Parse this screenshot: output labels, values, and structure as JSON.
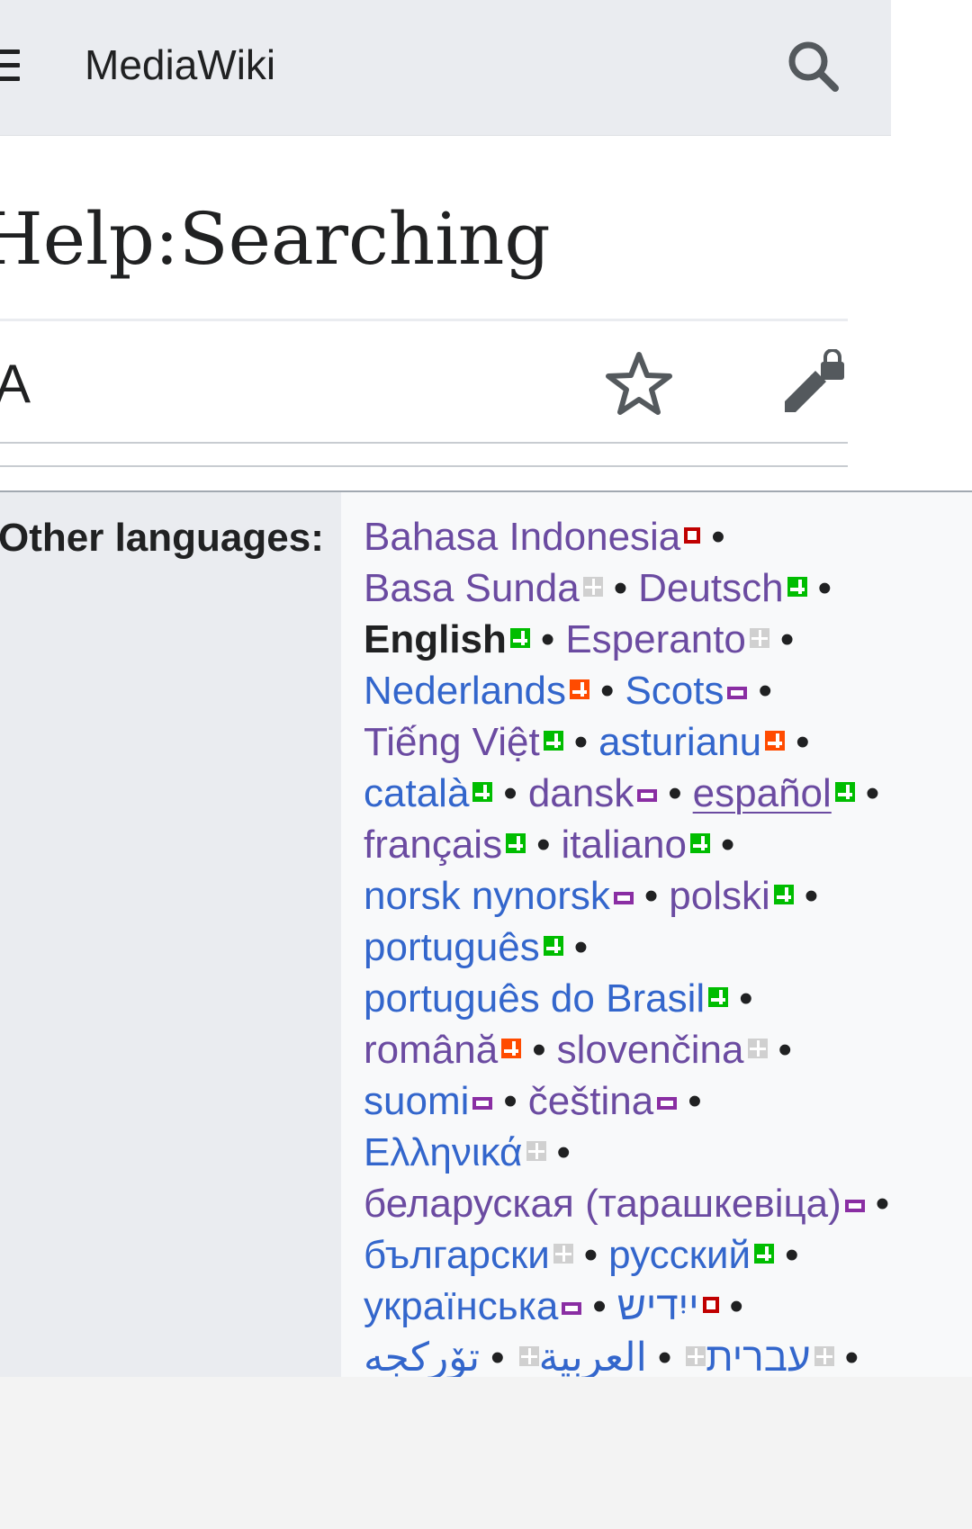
{
  "header": {
    "site_name": "MediaWiki",
    "icons": {
      "menu": "hamburger-menu-icon",
      "search": "search-icon"
    }
  },
  "page": {
    "title": "Help:Searching"
  },
  "actions": {
    "language_icon_text": "A",
    "icons": {
      "language": "language-icon",
      "watch": "star-icon",
      "edit": "edit-lock-icon"
    }
  },
  "languages": {
    "label": "Other languages:",
    "separator": "•",
    "lines": [
      [
        {
          "name": "Bahasa Indonesia",
          "style": "visited",
          "status": "low"
        }
      ],
      [
        {
          "name": "Basa Sunda",
          "style": "visited",
          "status": "none"
        },
        {
          "name": "Deutsch",
          "style": "visited",
          "status": "complete"
        }
      ],
      [
        {
          "name": "English",
          "style": "current",
          "status": "complete"
        },
        {
          "name": "Esperanto",
          "style": "visited",
          "status": "none"
        }
      ],
      [
        {
          "name": "Nederlands",
          "style": "link",
          "status": "high"
        },
        {
          "name": "Scots",
          "style": "link",
          "status": "mid"
        }
      ],
      [
        {
          "name": "Tiếng Việt",
          "style": "visited",
          "status": "complete"
        },
        {
          "name": "asturianu",
          "style": "link",
          "status": "high"
        }
      ],
      [
        {
          "name": "català",
          "style": "link",
          "status": "complete"
        },
        {
          "name": "dansk",
          "style": "visited",
          "status": "mid"
        },
        {
          "name": "español",
          "style": "visited-underline",
          "status": "complete"
        }
      ],
      [
        {
          "name": "français",
          "style": "visited",
          "status": "complete"
        },
        {
          "name": "italiano",
          "style": "visited",
          "status": "complete"
        }
      ],
      [
        {
          "name": "norsk nynorsk",
          "style": "link",
          "status": "mid"
        },
        {
          "name": "polski",
          "style": "visited",
          "status": "complete"
        }
      ],
      [
        {
          "name": "português",
          "style": "link",
          "status": "complete"
        }
      ],
      [
        {
          "name": "português do Brasil",
          "style": "link",
          "status": "complete"
        }
      ],
      [
        {
          "name": "română",
          "style": "visited",
          "status": "high"
        },
        {
          "name": "slovenčina",
          "style": "visited",
          "status": "none"
        }
      ],
      [
        {
          "name": "suomi",
          "style": "link",
          "status": "mid"
        },
        {
          "name": "čeština",
          "style": "visited",
          "status": "mid"
        }
      ],
      [
        {
          "name": "Ελληνικά",
          "style": "link",
          "status": "none"
        }
      ],
      [
        {
          "name": "беларуская (тарашкевіца)",
          "style": "visited",
          "status": "mid"
        }
      ],
      [
        {
          "name": "български",
          "style": "link",
          "status": "none"
        },
        {
          "name": "русский",
          "style": "link",
          "status": "complete"
        }
      ],
      [
        {
          "name": "українська",
          "style": "link",
          "status": "mid"
        },
        {
          "name": "ייִדיש",
          "style": "link",
          "status": "low"
        }
      ],
      [
        {
          "name": "עברית",
          "style": "link",
          "status": "none"
        },
        {
          "name": "العربية",
          "style": "link",
          "status": "none"
        },
        {
          "name": "تۆرکجه",
          "style": "link",
          "status": "none"
        }
      ]
    ]
  },
  "colors": {
    "link": "#3366cc",
    "visited_link": "#6b4ba1",
    "header_bg": "#eaecf0",
    "status_complete": "#00bd00",
    "status_high": "#ff4b00",
    "status_mid": "#8a2ea3",
    "status_low": "#c00000",
    "status_none": "#d0d0d0"
  }
}
